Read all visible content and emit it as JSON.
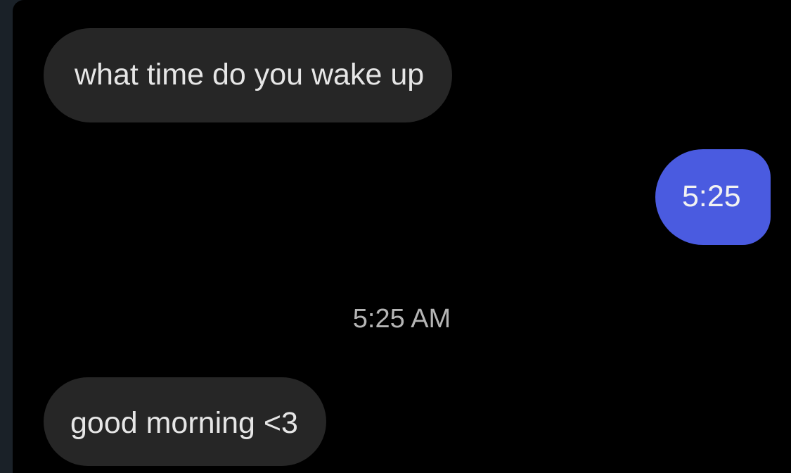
{
  "theme": {
    "background": "#000000",
    "incoming_bubble": "#262626",
    "outgoing_bubble": "#4a5be0"
  },
  "conversation": {
    "messages": [
      {
        "direction": "incoming",
        "text": "what time do you wake up"
      },
      {
        "direction": "outgoing",
        "text": "5:25"
      },
      {
        "direction": "incoming",
        "text": "good morning <3"
      }
    ],
    "timestamp": "5:25 AM"
  }
}
